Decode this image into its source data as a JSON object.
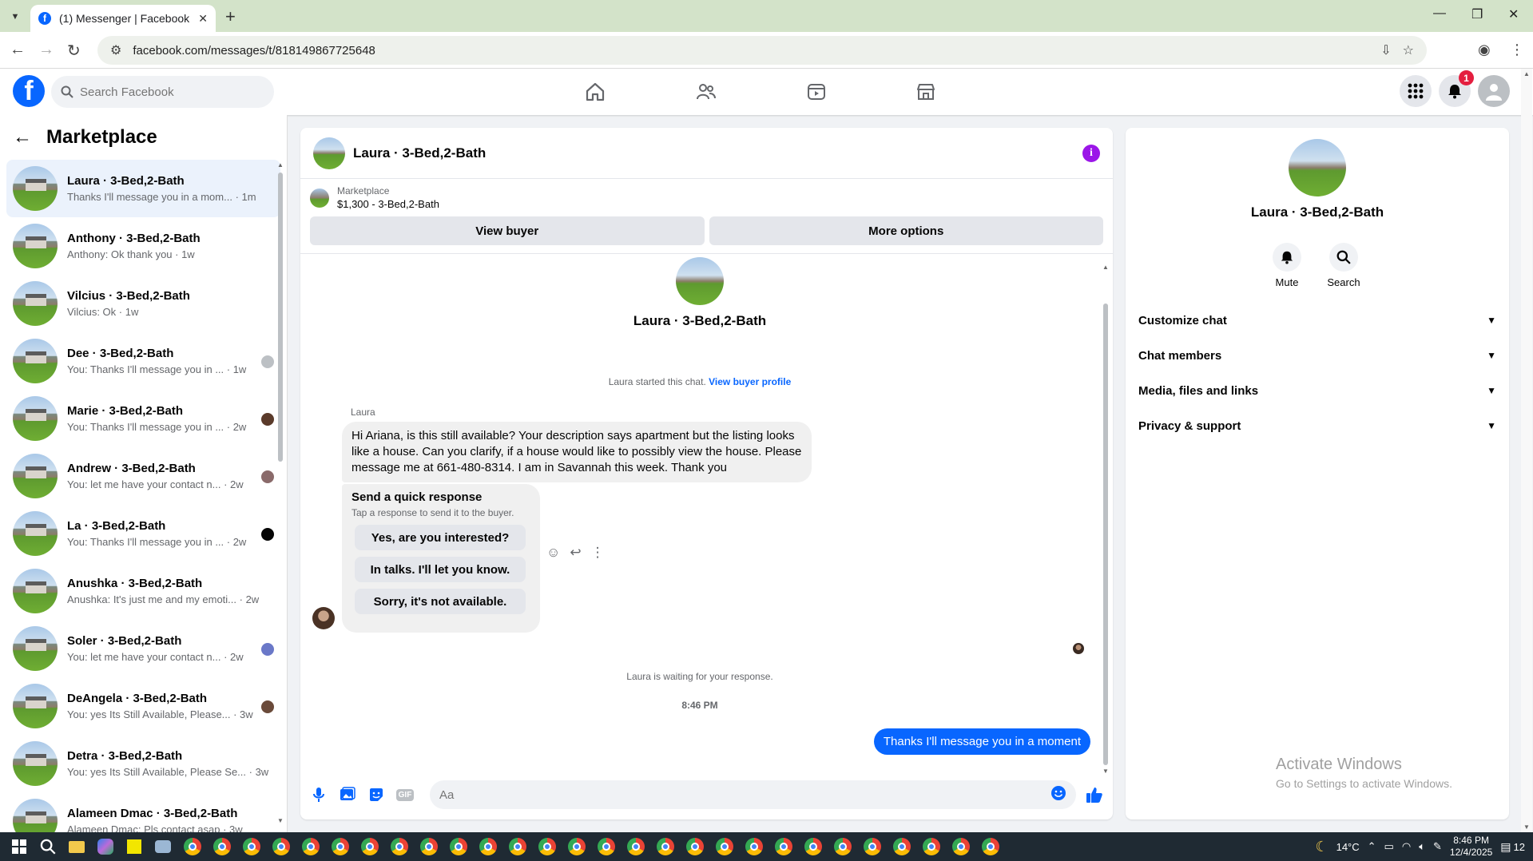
{
  "browser": {
    "tab_title": "(1) Messenger | Facebook",
    "url": "facebook.com/messages/t/818149867725648"
  },
  "header": {
    "search_placeholder": "Search Facebook",
    "notification_count": "1"
  },
  "sidebar": {
    "title": "Marketplace",
    "conversations": [
      {
        "name": "Laura · 3-Bed,2-Bath",
        "snippet": "Thanks I'll message you in a mom... · 1m",
        "active": true
      },
      {
        "name": "Anthony · 3-Bed,2-Bath",
        "snippet": "Anthony: Ok thank you · 1w"
      },
      {
        "name": "Vilcius · 3-Bed,2-Bath",
        "snippet": "Vilcius: Ok · 1w"
      },
      {
        "name": "Dee · 3-Bed,2-Bath",
        "snippet": "You: Thanks I'll message you in ... · 1w"
      },
      {
        "name": "Marie · 3-Bed,2-Bath",
        "snippet": "You: Thanks I'll message you in ... · 2w"
      },
      {
        "name": "Andrew · 3-Bed,2-Bath",
        "snippet": "You: let me have your contact n... · 2w"
      },
      {
        "name": "La · 3-Bed,2-Bath",
        "snippet": "You: Thanks I'll message you in ... · 2w"
      },
      {
        "name": "Anushka · 3-Bed,2-Bath",
        "snippet": "Anushka: It's just me and my emoti... · 2w"
      },
      {
        "name": "Soler · 3-Bed,2-Bath",
        "snippet": "You: let me have your contact n... · 2w"
      },
      {
        "name": "DeAngela · 3-Bed,2-Bath",
        "snippet": "You: yes Its Still Available, Please... · 3w"
      },
      {
        "name": "Detra · 3-Bed,2-Bath",
        "snippet": "You: yes Its Still Available, Please Se... · 3w"
      },
      {
        "name": "Alameen Dmac · 3-Bed,2-Bath",
        "snippet": "Alameen Dmac: Pls contact asap · 3w"
      }
    ]
  },
  "chat": {
    "title": "Laura · 3-Bed,2-Bath",
    "listing_label": "Marketplace",
    "listing_price": "$1,300 - 3-Bed,2-Bath",
    "view_buyer": "View buyer",
    "more_options": "More options",
    "intro_name": "Laura · 3-Bed,2-Bath",
    "started_text": "Laura started this chat.",
    "view_buyer_profile": "View buyer profile",
    "sender_name": "Laura",
    "incoming_message": "Hi Ariana, is this still available? Your description says apartment but the listing looks like a house. Can you clarify, if a house would like to possibly view the house. Please message me at 661-480-8314. I am in Savannah this week. Thank you",
    "quick_title": "Send a quick response",
    "quick_subtitle": "Tap a response to send it to the buyer.",
    "quick_responses": [
      "Yes, are you interested?",
      "In talks. I'll let you know.",
      "Sorry, it's not available."
    ],
    "waiting_text": "Laura is waiting for your response.",
    "timestamp": "8:46 PM",
    "outgoing_message": "Thanks I'll message you in a moment",
    "composer_placeholder": "Aa",
    "gif_label": "GIF"
  },
  "info_panel": {
    "name": "Laura · 3-Bed,2-Bath",
    "mute_label": "Mute",
    "search_label": "Search",
    "sections": [
      "Customize chat",
      "Chat members",
      "Media, files and links",
      "Privacy & support"
    ],
    "watermark_title": "Activate Windows",
    "watermark_sub": "Go to Settings to activate Windows."
  },
  "taskbar": {
    "weather": "14°C",
    "time": "8:46 PM",
    "date": "12/4/2025",
    "notif_count": "12"
  },
  "colors": {
    "fb_blue": "#0866ff",
    "info_purple": "#9b16e8",
    "active_row": "#ebf2fc"
  }
}
